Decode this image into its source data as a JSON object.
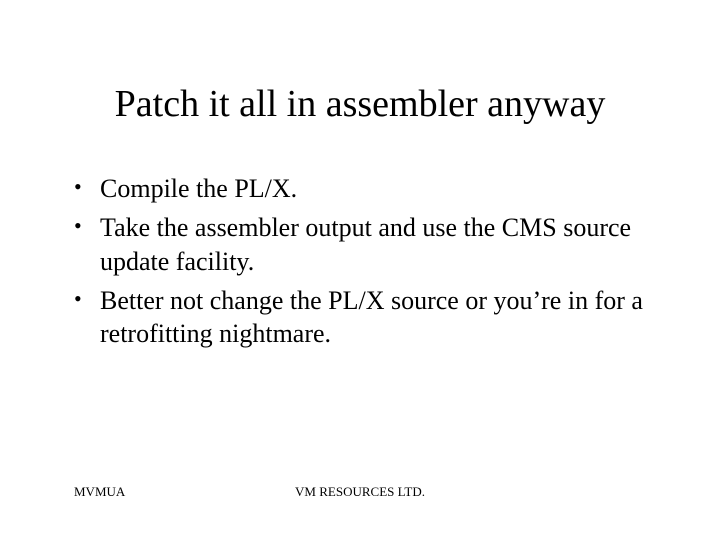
{
  "slide": {
    "title": "Patch it all in assembler anyway",
    "bullets": [
      "Compile the PL/X.",
      "Take the assembler output and use the CMS source update facility.",
      "Better not change the PL/X source or you’re in for a retrofitting nightmare."
    ],
    "footer": {
      "left": "MVMUA",
      "center": "VM RESOURCES LTD."
    }
  }
}
